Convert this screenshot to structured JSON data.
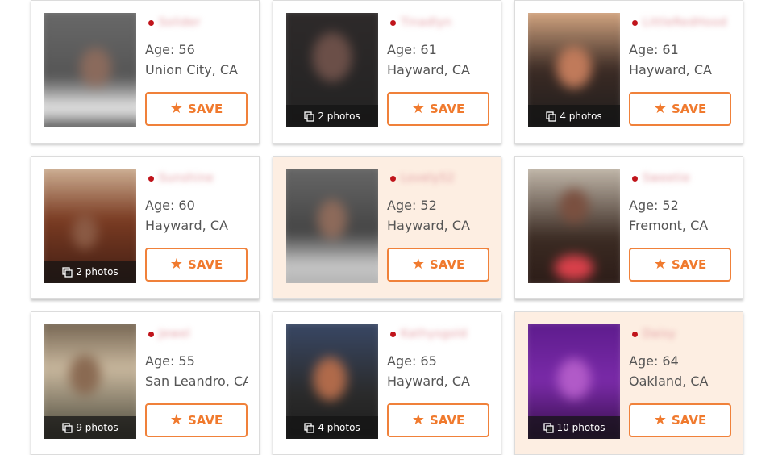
{
  "save_label": "SAVE",
  "accent_color": "#f07a2e",
  "online_color": "#c0141b",
  "icons": {
    "save": "star-icon",
    "photos": "copy-icon",
    "online": "dot"
  },
  "profiles": [
    {
      "age": "Age: 56",
      "location": "Union City, CA",
      "name": "Solider",
      "photos": "",
      "highlight": false
    },
    {
      "age": "Age: 61",
      "location": "Hayward, CA",
      "name": "Tinadlyn",
      "photos": "2 photos",
      "highlight": false
    },
    {
      "age": "Age: 61",
      "location": "Hayward, CA",
      "name": "LittleRedHood",
      "photos": "4 photos",
      "highlight": false
    },
    {
      "age": "Age: 60",
      "location": "Hayward, CA",
      "name": "Sunshine",
      "photos": "2 photos",
      "highlight": false
    },
    {
      "age": "Age: 52",
      "location": "Hayward, CA",
      "name": "Lovely52",
      "photos": "",
      "highlight": true
    },
    {
      "age": "Age: 52",
      "location": "Fremont, CA",
      "name": "Sweetie",
      "photos": "",
      "highlight": false
    },
    {
      "age": "Age: 55",
      "location": "San Leandro, CA",
      "name": "Jewel",
      "photos": "9 photos",
      "highlight": false
    },
    {
      "age": "Age: 65",
      "location": "Hayward, CA",
      "name": "Kathysgold",
      "photos": "4 photos",
      "highlight": false
    },
    {
      "age": "Age: 64",
      "location": "Oakland, CA",
      "name": "Daisy",
      "photos": "10 photos",
      "highlight": true
    }
  ]
}
